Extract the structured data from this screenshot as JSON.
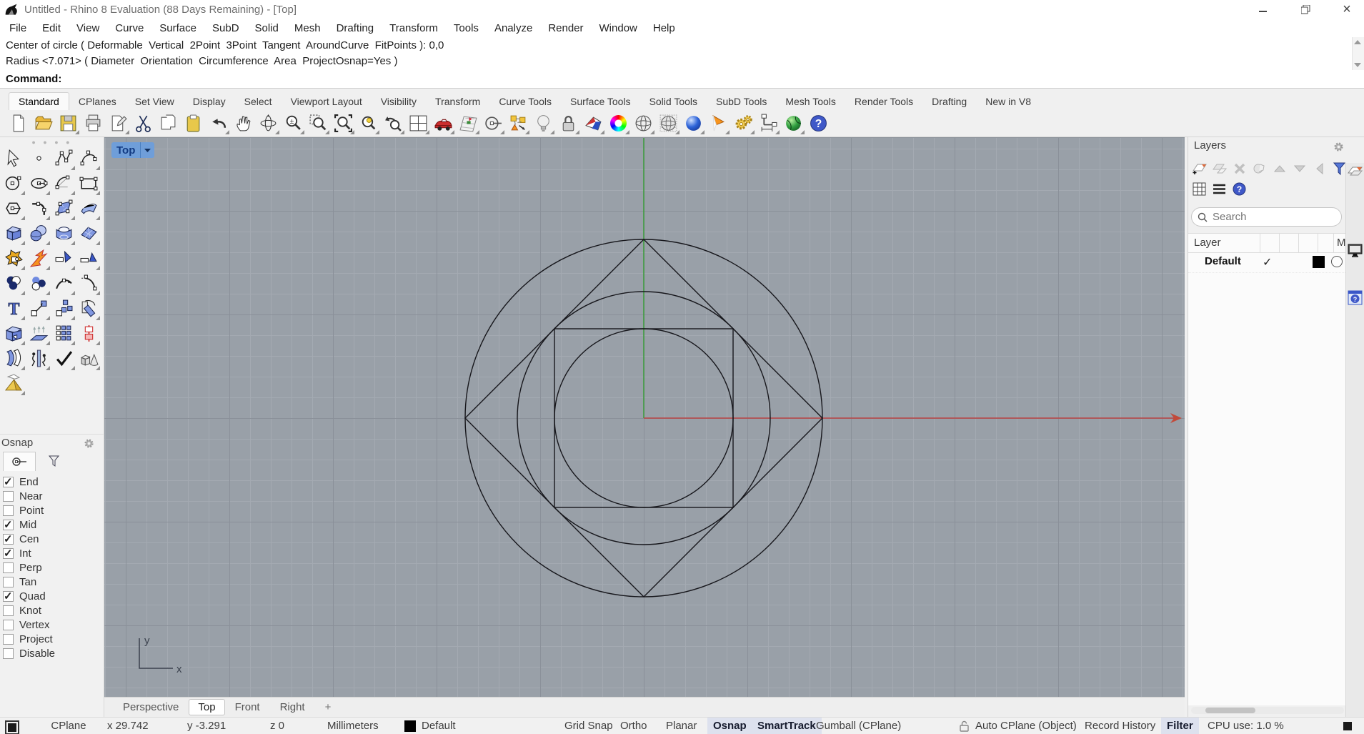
{
  "window": {
    "title": "Untitled - Rhino 8 Evaluation (88 Days Remaining) - [Top]"
  },
  "menubar": {
    "items": [
      "File",
      "Edit",
      "View",
      "Curve",
      "Surface",
      "SubD",
      "Solid",
      "Mesh",
      "Drafting",
      "Transform",
      "Tools",
      "Analyze",
      "Render",
      "Window",
      "Help"
    ]
  },
  "command": {
    "history": [
      "Center of circle ( Deformable  Vertical  2Point  3Point  Tangent  AroundCurve  FitPoints ): 0,0",
      "Radius <7.071> ( Diameter  Orientation  Circumference  Area  ProjectOsnap=Yes )"
    ],
    "prompt": "Command:"
  },
  "toolbar_tabs": {
    "active": "Standard",
    "items": [
      "Standard",
      "CPlanes",
      "Set View",
      "Display",
      "Select",
      "Viewport Layout",
      "Visibility",
      "Transform",
      "Curve Tools",
      "Surface Tools",
      "Solid Tools",
      "SubD Tools",
      "Mesh Tools",
      "Render Tools",
      "Drafting",
      "New in V8"
    ]
  },
  "osnap": {
    "title": "Osnap",
    "items": [
      {
        "label": "End",
        "check": "✓"
      },
      {
        "label": "Near",
        "check": ""
      },
      {
        "label": "Point",
        "check": ""
      },
      {
        "label": "Mid",
        "check": "✓"
      },
      {
        "label": "Cen",
        "check": "✓"
      },
      {
        "label": "Int",
        "check": "✓"
      },
      {
        "label": "Perp",
        "check": ""
      },
      {
        "label": "Tan",
        "check": ""
      },
      {
        "label": "Quad",
        "check": "✓"
      },
      {
        "label": "Knot",
        "check": ""
      },
      {
        "label": "Vertex",
        "check": ""
      },
      {
        "label": "Project",
        "check": ""
      },
      {
        "label": "Disable",
        "check": ""
      }
    ]
  },
  "viewport": {
    "label": "Top",
    "axis": {
      "x": "x",
      "y": "y"
    },
    "colors": {
      "background": "#99a0a8",
      "x_axis": "#b94343",
      "y_axis": "#3f9b3f",
      "curves": "#17171c",
      "badge": "#6f9ed9"
    }
  },
  "layers_panel": {
    "title": "Layers",
    "search_placeholder": "Search",
    "columns": {
      "layer": "Layer",
      "material": "M"
    },
    "rows": [
      {
        "name": "Default",
        "current": "✓",
        "color": "#000000"
      }
    ]
  },
  "viewport_tabs": {
    "active": "Top",
    "items": [
      "Perspective",
      "Top",
      "Front",
      "Right",
      "+"
    ]
  },
  "statusbar": {
    "cplane": "CPlane",
    "x": "x 29.742",
    "y": "y -3.291",
    "z": "z 0",
    "units": "Millimeters",
    "layer": "Default",
    "layer_color": "#000000",
    "grid_snap": "Grid Snap",
    "ortho": "Ortho",
    "planar": "Planar",
    "osnap": "Osnap",
    "smarttrack": "SmartTrack",
    "gumball": "Gumball (CPlane)",
    "auto_cplane": "Auto CPlane (Object)",
    "record_history": "Record History",
    "filter": "Filter",
    "cpu": "CPU use: 1.0 %"
  }
}
